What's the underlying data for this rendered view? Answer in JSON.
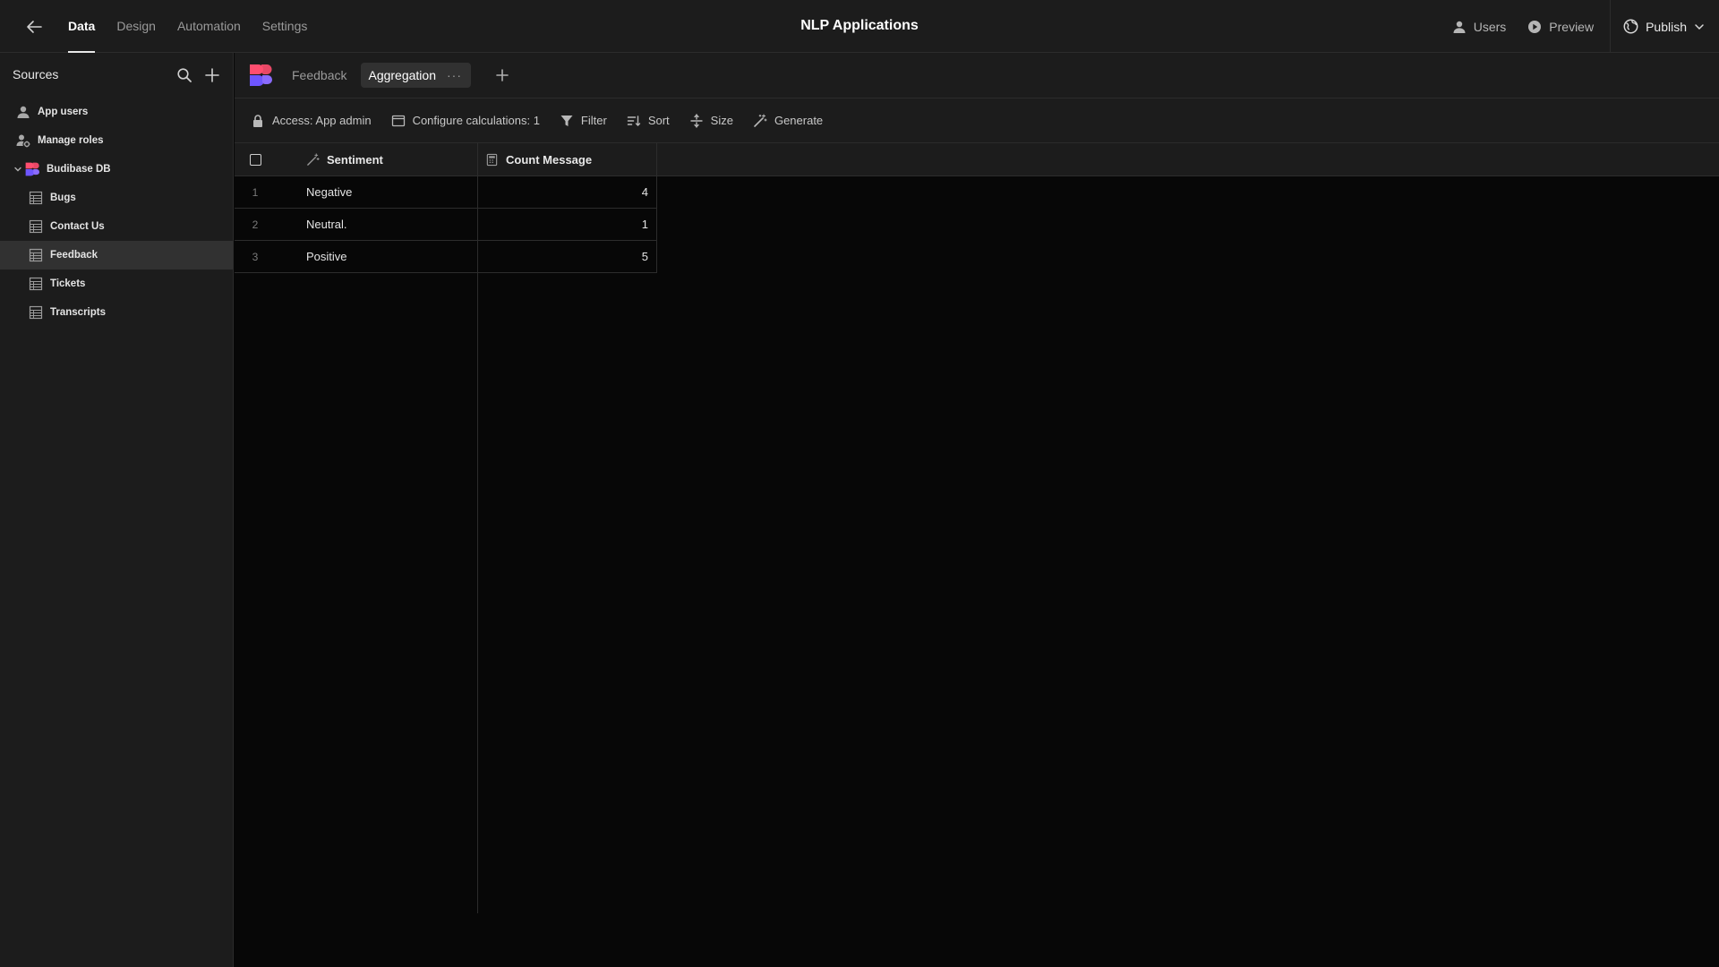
{
  "header": {
    "title": "NLP Applications",
    "tabs": [
      {
        "label": "Data",
        "active": true
      },
      {
        "label": "Design",
        "active": false
      },
      {
        "label": "Automation",
        "active": false
      },
      {
        "label": "Settings",
        "active": false
      }
    ],
    "users_label": "Users",
    "preview_label": "Preview",
    "publish_label": "Publish"
  },
  "sidebar": {
    "title": "Sources",
    "items": [
      {
        "label": "App users",
        "icon": "user-icon"
      },
      {
        "label": "Manage roles",
        "icon": "roles-icon"
      },
      {
        "label": "Budibase DB",
        "icon": "budibase-logo",
        "expanded": true
      },
      {
        "label": "Bugs",
        "icon": "table-icon"
      },
      {
        "label": "Contact Us",
        "icon": "table-icon"
      },
      {
        "label": "Feedback",
        "icon": "table-icon",
        "selected": true
      },
      {
        "label": "Tickets",
        "icon": "table-icon"
      },
      {
        "label": "Transcripts",
        "icon": "table-icon"
      }
    ]
  },
  "views": {
    "tabs": [
      {
        "label": "Feedback",
        "active": false
      },
      {
        "label": "Aggregation",
        "active": true
      }
    ],
    "more": "···"
  },
  "toolbar": {
    "access": "Access: App admin",
    "calculations": "Configure calculations: 1",
    "filter": "Filter",
    "sort": "Sort",
    "size": "Size",
    "generate": "Generate"
  },
  "table": {
    "columns": [
      {
        "label": "Sentiment",
        "icon": "magic-wand-icon"
      },
      {
        "label": "Count Message",
        "icon": "calculator-icon"
      }
    ],
    "rows": [
      {
        "num": "1",
        "sentiment": "Negative",
        "count": "4"
      },
      {
        "num": "2",
        "sentiment": "Neutral.",
        "count": "1"
      },
      {
        "num": "3",
        "sentiment": "Positive",
        "count": "5"
      }
    ]
  },
  "colors": {
    "background": "#070707",
    "panel": "#1c1c1c",
    "border": "#2c2c2c",
    "selected": "#313131",
    "brand_pink": "#ff4e6f",
    "brand_purple": "#6e56ff"
  }
}
